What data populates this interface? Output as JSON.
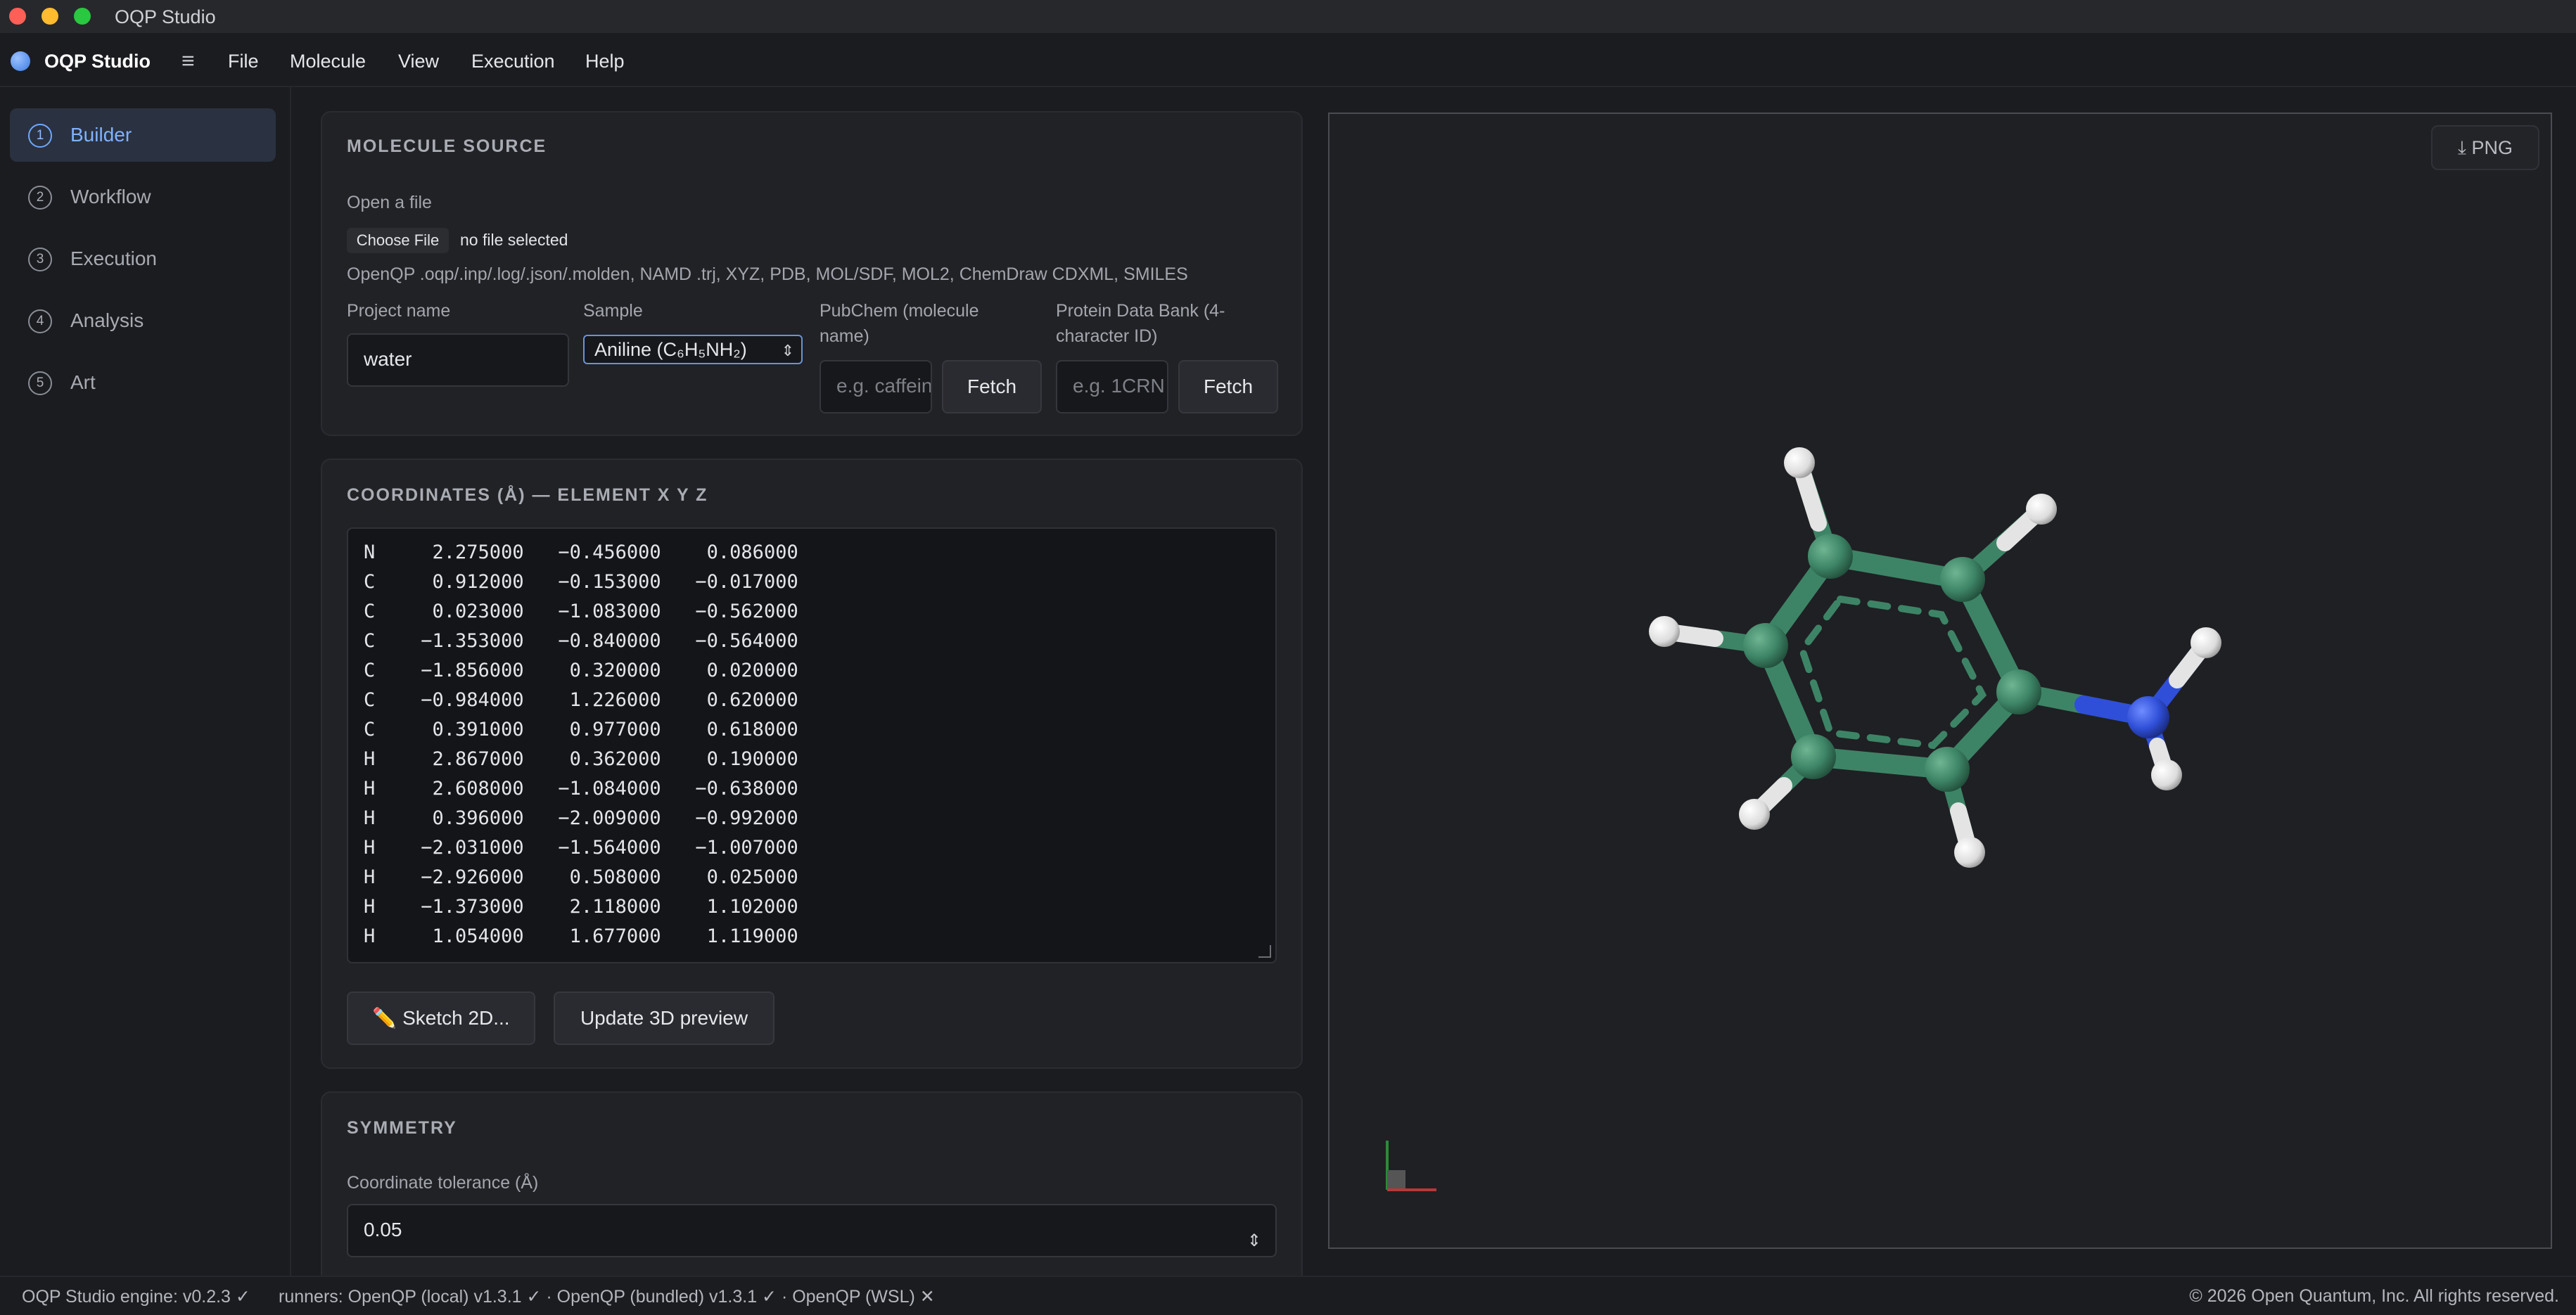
{
  "window": {
    "title": "OQP Studio"
  },
  "app": {
    "name": "OQP Studio",
    "menu_icon": "≡"
  },
  "menu": [
    "File",
    "Molecule",
    "View",
    "Execution",
    "Help"
  ],
  "sidebar": {
    "items": [
      {
        "num": "1",
        "label": "Builder",
        "active": true
      },
      {
        "num": "2",
        "label": "Workflow",
        "active": false
      },
      {
        "num": "3",
        "label": "Execution",
        "active": false
      },
      {
        "num": "4",
        "label": "Analysis",
        "active": false
      },
      {
        "num": "5",
        "label": "Art",
        "active": false
      }
    ]
  },
  "source": {
    "title": "MOLECULE SOURCE",
    "open_label": "Open a file",
    "choose_file": "Choose File",
    "file_status": "no file selected",
    "formats": "OpenQP .oqp/.inp/.log/.json/.molden, NAMD .trj, XYZ, PDB, MOL/SDF, MOL2, ChemDraw CDXML, SMILES",
    "project_label": "Project name",
    "project_value": "water",
    "sample_label": "Sample",
    "sample_value": "Aniline (C₆H₅NH₂)",
    "pubchem_label_1": "PubChem (molecule",
    "pubchem_label_2": "name)",
    "pubchem_placeholder": "e.g. caffeine",
    "pubchem_fetch": "Fetch",
    "pdb_label_1": "Protein Data Bank (4-",
    "pdb_label_2": "character ID)",
    "pdb_placeholder": "e.g. 1CRN",
    "pdb_fetch": "Fetch"
  },
  "coords": {
    "title": "COORDINATES (Å) — ELEMENT X Y Z",
    "rows": [
      "N     2.275000   −0.456000    0.086000",
      "C     0.912000   −0.153000   −0.017000",
      "C     0.023000   −1.083000   −0.562000",
      "C    −1.353000   −0.840000   −0.564000",
      "C    −1.856000    0.320000    0.020000",
      "C    −0.984000    1.226000    0.620000",
      "C     0.391000    0.977000    0.618000",
      "H     2.867000    0.362000    0.190000",
      "H     2.608000   −1.084000   −0.638000",
      "H     0.396000   −2.009000   −0.992000",
      "H    −2.031000   −1.564000   −1.007000",
      "H    −2.926000    0.508000    0.025000",
      "H    −1.373000    2.118000    1.102000",
      "H     1.054000    1.677000    1.119000"
    ],
    "sketch_button": "✏️ Sketch 2D...",
    "update_button": "Update 3D preview"
  },
  "symmetry": {
    "title": "SYMMETRY",
    "tolerance_label": "Coordinate tolerance (Å)",
    "tolerance_value": "0.05"
  },
  "viewer": {
    "png_button": "⤓ PNG",
    "colors": {
      "carbon": "#3d8466",
      "hydrogen": "#e8e8e8",
      "nitrogen": "#2f4fd8",
      "background": "#1f2023"
    }
  },
  "status": {
    "engine": "OQP Studio engine: v0.2.3 ✓",
    "runners": "runners: OpenQP (local) v1.3.1 ✓ · OpenQP (bundled) v1.3.1 ✓ · OpenQP (WSL) ✕",
    "copyright": "© 2026 Open Quantum, Inc. All rights reserved."
  }
}
